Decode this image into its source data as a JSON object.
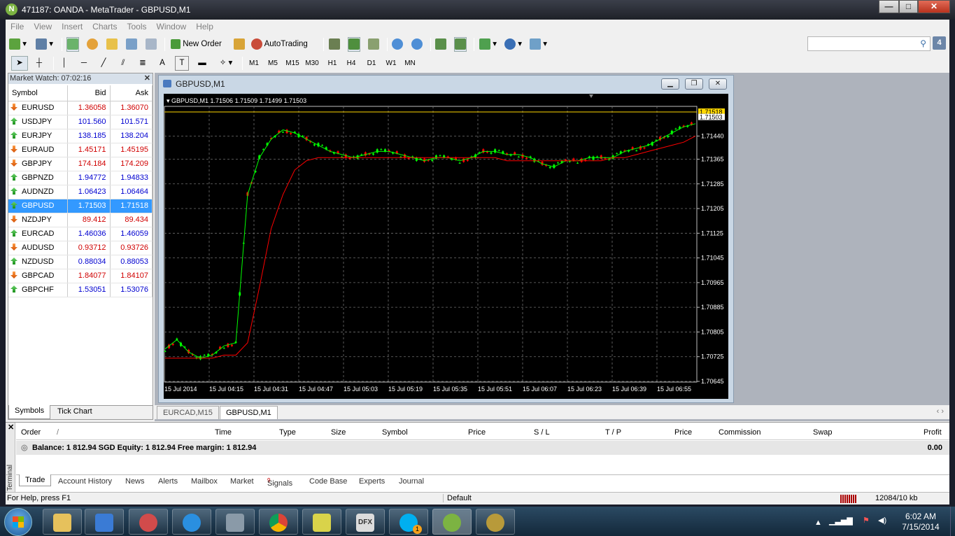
{
  "window": {
    "title": "471187: OANDA - MetaTrader - GBPUSD,M1",
    "app_letter": "N"
  },
  "menu": [
    "File",
    "View",
    "Insert",
    "Charts",
    "Tools",
    "Window",
    "Help"
  ],
  "toolbar": {
    "new_order": "New Order",
    "autotrading": "AutoTrading",
    "search_placeholder": "",
    "notifications": "4"
  },
  "timeframes": [
    "M1",
    "M5",
    "M15",
    "M30",
    "H1",
    "H4",
    "D1",
    "W1",
    "MN"
  ],
  "timeframe_selected": "M1",
  "draw_tools": {
    "text_tool": "A",
    "label_tool": "T"
  },
  "market_watch": {
    "title": "Market Watch: 07:02:16",
    "columns": {
      "symbol": "Symbol",
      "bid": "Bid",
      "ask": "Ask"
    },
    "rows": [
      {
        "symbol": "EURUSD",
        "bid": "1.36058",
        "ask": "1.36070",
        "dir": "down"
      },
      {
        "symbol": "USDJPY",
        "bid": "101.560",
        "ask": "101.571",
        "dir": "up"
      },
      {
        "symbol": "EURJPY",
        "bid": "138.185",
        "ask": "138.204",
        "dir": "up"
      },
      {
        "symbol": "EURAUD",
        "bid": "1.45171",
        "ask": "1.45195",
        "dir": "down"
      },
      {
        "symbol": "GBPJPY",
        "bid": "174.184",
        "ask": "174.209",
        "dir": "down"
      },
      {
        "symbol": "GBPNZD",
        "bid": "1.94772",
        "ask": "1.94833",
        "dir": "up"
      },
      {
        "symbol": "AUDNZD",
        "bid": "1.06423",
        "ask": "1.06464",
        "dir": "up"
      },
      {
        "symbol": "GBPUSD",
        "bid": "1.71503",
        "ask": "1.71518",
        "dir": "up",
        "selected": true
      },
      {
        "symbol": "NZDJPY",
        "bid": "89.412",
        "ask": "89.434",
        "dir": "down"
      },
      {
        "symbol": "EURCAD",
        "bid": "1.46036",
        "ask": "1.46059",
        "dir": "up"
      },
      {
        "symbol": "AUDUSD",
        "bid": "0.93712",
        "ask": "0.93726",
        "dir": "down"
      },
      {
        "symbol": "NZDUSD",
        "bid": "0.88034",
        "ask": "0.88053",
        "dir": "up"
      },
      {
        "symbol": "GBPCAD",
        "bid": "1.84077",
        "ask": "1.84107",
        "dir": "down"
      },
      {
        "symbol": "GBPCHF",
        "bid": "1.53051",
        "ask": "1.53076",
        "dir": "up"
      }
    ],
    "tabs": [
      "Symbols",
      "Tick Chart"
    ]
  },
  "chart_window": {
    "title": "GBPUSD,M1"
  },
  "chart_data": {
    "type": "line",
    "header": "GBPUSD,M1  1.71506 1.71509 1.71499 1.71503",
    "ylim": [
      1.70645,
      1.71518
    ],
    "y_ticks": [
      "1.71440",
      "1.71365",
      "1.71285",
      "1.71205",
      "1.71125",
      "1.71045",
      "1.70965",
      "1.70885",
      "1.70805",
      "1.70725",
      "1.70645"
    ],
    "x_ticks": [
      "15 Jul 2014",
      "15 Jul 04:15",
      "15 Jul 04:31",
      "15 Jul 04:47",
      "15 Jul 05:03",
      "15 Jul 05:19",
      "15 Jul 05:35",
      "15 Jul 05:51",
      "15 Jul 06:07",
      "15 Jul 06:23",
      "15 Jul 06:39",
      "15 Jul 06:55"
    ],
    "ask_label": "1.71518",
    "bid_label": "1.71503",
    "series": [
      {
        "color": "#00ff00",
        "values": [
          1.7075,
          1.7078,
          1.7074,
          1.7072,
          1.7073,
          1.7076,
          1.7077,
          1.7125,
          1.7137,
          1.7143,
          1.7146,
          1.7145,
          1.7143,
          1.7141,
          1.7139,
          1.7138,
          1.7137,
          1.7138,
          1.7139,
          1.7139,
          1.7138,
          1.7137,
          1.7136,
          1.7137,
          1.7137,
          1.7136,
          1.7137,
          1.7139,
          1.7139,
          1.7138,
          1.7138,
          1.7137,
          1.7135,
          1.7134,
          1.7136,
          1.7136,
          1.7137,
          1.7137,
          1.7137,
          1.7139,
          1.714,
          1.7141,
          1.7143,
          1.7145,
          1.7147,
          1.7148
        ]
      },
      {
        "color": "#ff0000",
        "values": [
          1.7072,
          1.7072,
          1.7072,
          1.7072,
          1.7072,
          1.7073,
          1.7073,
          1.7077,
          1.7095,
          1.7114,
          1.7125,
          1.7133,
          1.7136,
          1.7137,
          1.7137,
          1.7137,
          1.7137,
          1.7137,
          1.7137,
          1.7137,
          1.7137,
          1.7137,
          1.7137,
          1.7137,
          1.7137,
          1.7137,
          1.7137,
          1.7137,
          1.7137,
          1.7136,
          1.7136,
          1.7136,
          1.7136,
          1.7136,
          1.7136,
          1.7136,
          1.7136,
          1.7136,
          1.7137,
          1.7137,
          1.7138,
          1.7139,
          1.714,
          1.7141,
          1.7142,
          1.7144
        ]
      }
    ]
  },
  "doc_tabs": [
    "EURCAD,M15",
    "GBPUSD,M1"
  ],
  "terminal": {
    "side_label": "Terminal",
    "columns": [
      "Order",
      "/",
      "Time",
      "Type",
      "Size",
      "Symbol",
      "Price",
      "S / L",
      "T / P",
      "Price",
      "Commission",
      "Swap",
      "Profit"
    ],
    "balance_line": "Balance: 1 812.94 SGD  Equity: 1 812.94  Free margin: 1 812.94",
    "profit": "0.00",
    "tabs": [
      "Trade",
      "Account History",
      "News",
      "Alerts",
      "Mailbox",
      "Market",
      "Signals",
      "Code Base",
      "Experts",
      "Journal"
    ],
    "signals_badge": "9"
  },
  "status": {
    "help": "For Help, press F1",
    "profile": "Default",
    "traffic": "12084/10 kb"
  },
  "clock": {
    "time": "6:02 AM",
    "date": "7/15/2014"
  },
  "taskbar_badge": "1",
  "taskbar_dfx": "DFX"
}
